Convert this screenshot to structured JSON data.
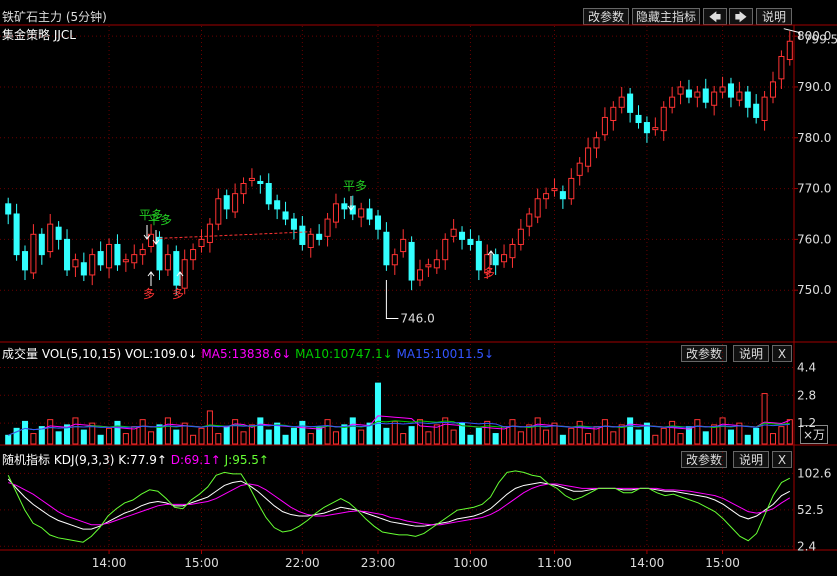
{
  "header": {
    "title": "铁矿石主力 (5分钟)",
    "change_params": "改参数",
    "hide_main_indicator": "隐藏主指标",
    "left_arrow": "🡄",
    "right_arrow": "🡆",
    "explain": "说明"
  },
  "strategy": "集金策略 JJCL",
  "signals": [
    {
      "text": "平多",
      "color": "#22cc22"
    },
    {
      "text": "平多",
      "color": "#22cc22"
    },
    {
      "text": "平多",
      "color": "#22cc22"
    },
    {
      "text": "多",
      "color": "#ff3333"
    },
    {
      "text": "多",
      "color": "#ff3333"
    },
    {
      "text": "多",
      "color": "#ff3333"
    }
  ],
  "annotations": {
    "high": "799.5",
    "low": "746.0"
  },
  "volume": {
    "label": "成交量",
    "params": "VOL(5,10,15)",
    "vol": "VOL:109.0↓",
    "ma5": "MA5:13838.6↓",
    "ma10": "MA10:10747.1↓",
    "ma15": "MA15:10011.5↓",
    "change_params": "改参数",
    "explain": "说明",
    "close": "X",
    "unit": "×万",
    "colors": {
      "ma5": "#ff00ff",
      "ma10": "#00cc00",
      "ma15": "#3355ff"
    }
  },
  "kdj": {
    "label": "随机指标",
    "params": "KDJ(9,3,3)",
    "k": "K:77.9↑",
    "d": "D:69.1↑",
    "j": "J:95.5↑",
    "change_params": "改参数",
    "explain": "说明",
    "close": "X",
    "colors": {
      "k": "#ffffff",
      "d": "#ff00ff",
      "j": "#66ff33"
    }
  },
  "colors": {
    "up": "#ff3333",
    "down": "#33ffff",
    "border": "#a00000"
  },
  "chart_data": [
    {
      "type": "candlestick",
      "title": "铁矿石主力 (5分钟)",
      "ylim": [
        740,
        802
      ],
      "yticks": [
        "800.0",
        "790.0",
        "780.0",
        "770.0",
        "760.0",
        "750.0"
      ],
      "ytick_values": [
        800,
        790,
        780,
        770,
        760,
        750
      ],
      "xticks": [
        "14:00",
        "15:00",
        "22:00",
        "23:00",
        "10:00",
        "11:00",
        "14:00",
        "15:00"
      ],
      "xtick_bar_index": [
        12,
        23,
        35,
        44,
        55,
        65,
        76,
        85
      ],
      "closes": [
        765,
        757,
        754,
        761,
        757,
        763,
        760,
        754,
        756,
        753,
        757,
        755,
        759,
        755,
        756,
        757,
        758,
        761,
        754,
        757,
        751,
        756,
        758,
        760,
        763,
        768,
        766,
        769,
        771,
        772,
        771,
        767,
        766,
        764,
        762,
        759,
        761,
        760,
        764,
        767,
        766,
        765,
        766,
        764,
        762,
        755,
        757,
        760,
        752,
        754,
        755,
        756,
        760,
        762,
        760,
        759,
        754,
        757,
        755,
        757,
        759,
        762,
        765,
        768,
        769,
        770,
        768,
        772,
        775,
        778,
        780,
        784,
        786,
        788,
        785,
        783,
        781,
        782,
        786,
        788,
        790,
        788,
        789,
        787,
        789,
        790,
        788,
        789,
        786,
        784,
        788,
        791,
        796,
        799
      ]
    },
    {
      "type": "bar",
      "title": "成交量",
      "ylim": [
        0,
        4.6
      ],
      "yticks": [
        "4.4",
        "2.8",
        "1.2"
      ],
      "ytick_values": [
        4.4,
        2.8,
        1.2
      ]
    },
    {
      "type": "line",
      "title": "随机指标",
      "ylim": [
        0,
        110
      ],
      "yticks": [
        "102.6",
        "52.5",
        "2.4"
      ],
      "ytick_values": [
        102.6,
        52.5,
        2.4
      ],
      "series": [
        {
          "name": "K",
          "values": [
            95,
            82,
            70,
            60,
            52,
            44,
            38,
            34,
            30,
            26,
            26,
            30,
            36,
            42,
            48,
            52,
            58,
            62,
            64,
            62,
            58,
            58,
            62,
            66,
            70,
            78,
            86,
            90,
            92,
            86,
            78,
            68,
            58,
            50,
            46,
            44,
            44,
            46,
            48,
            52,
            56,
            54,
            52,
            48,
            44,
            40,
            36,
            34,
            32,
            30,
            30,
            32,
            34,
            36,
            40,
            42,
            44,
            48,
            54,
            64,
            74,
            82,
            86,
            88,
            90,
            88,
            86,
            82,
            78,
            78,
            80,
            82,
            82,
            82,
            80,
            80,
            82,
            82,
            80,
            78,
            78,
            76,
            74,
            72,
            70,
            66,
            60,
            52,
            44,
            40,
            44,
            52,
            60,
            72,
            78
          ]
        },
        {
          "name": "D",
          "values": [
            90,
            86,
            80,
            74,
            66,
            58,
            50,
            44,
            40,
            36,
            32,
            32,
            34,
            38,
            42,
            46,
            50,
            54,
            58,
            60,
            60,
            60,
            60,
            62,
            64,
            68,
            74,
            80,
            86,
            88,
            86,
            80,
            72,
            64,
            56,
            50,
            46,
            44,
            44,
            46,
            48,
            50,
            51,
            50,
            48,
            46,
            42,
            40,
            37,
            35,
            33,
            32,
            32,
            34,
            36,
            38,
            40,
            42,
            46,
            52,
            60,
            68,
            76,
            82,
            86,
            88,
            88,
            86,
            84,
            82,
            82,
            82,
            82,
            82,
            82,
            82,
            82,
            82,
            82,
            80,
            80,
            79,
            78,
            76,
            74,
            72,
            68,
            62,
            56,
            50,
            48,
            50,
            54,
            62,
            69
          ]
        },
        {
          "name": "J",
          "values": [
            100,
            76,
            52,
            34,
            28,
            18,
            14,
            12,
            10,
            8,
            16,
            28,
            44,
            54,
            62,
            66,
            74,
            80,
            78,
            68,
            56,
            54,
            66,
            74,
            84,
            100,
            104,
            102,
            102,
            84,
            62,
            42,
            28,
            22,
            24,
            30,
            38,
            48,
            56,
            62,
            68,
            62,
            52,
            40,
            30,
            22,
            20,
            18,
            18,
            16,
            20,
            28,
            36,
            44,
            52,
            54,
            56,
            60,
            70,
            90,
            104,
            106,
            104,
            100,
            98,
            88,
            82,
            72,
            66,
            70,
            76,
            82,
            82,
            82,
            76,
            76,
            82,
            82,
            76,
            72,
            74,
            70,
            66,
            62,
            56,
            50,
            40,
            28,
            16,
            10,
            20,
            46,
            72,
            90,
            96
          ]
        }
      ]
    }
  ]
}
